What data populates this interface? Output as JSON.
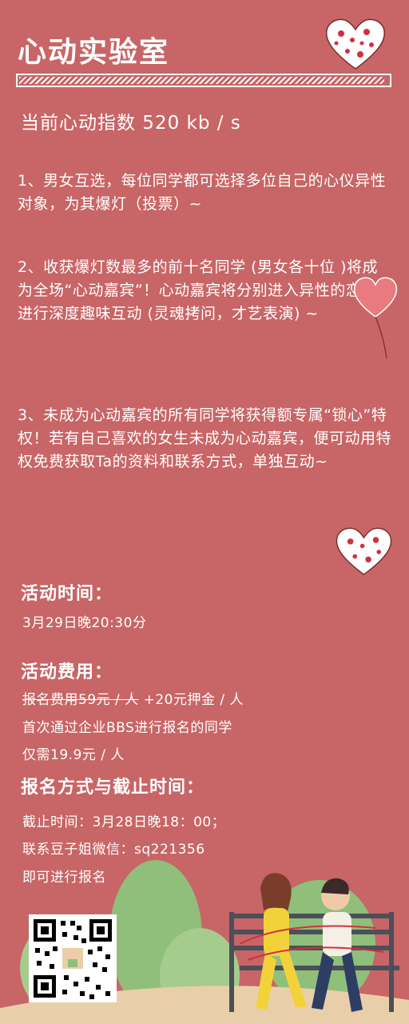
{
  "title": "心动实验室",
  "progress": 0.99,
  "index_text": "当前心动指数 520 kb / s",
  "rules": [
    "1、男女互选，每位同学都可选择多位自己的心仪异性对象，为其爆灯（投票）~",
    "2、收获爆灯数最多的前十名同学 (男女各十位 )将成为全场“心动嘉宾”！心动嘉宾将分别进入异性的恋爱群进行深度趣味互动 (灵魂拷问，才艺表演) ~",
    "3、未成为心动嘉宾的所有同学将获得额专属“锁心”特权！若有自己喜欢的女生未成为心动嘉宾，便可动用特权免费获取Ta的资料和联系方式，单独互动~"
  ],
  "time": {
    "heading": "活动时间：",
    "value": "3月29日晚20:30分"
  },
  "fee": {
    "heading": "活动费用：",
    "original": "报名费用59元 / 人",
    "deposit": " +20元押金 / 人",
    "note_line1": "首次通过企业BBS进行报名的同学",
    "note_line2": "仅需19.9元 / 人"
  },
  "signup": {
    "heading": "报名方式与截止时间：",
    "deadline": "截止时间：3月28日晚18：00；",
    "contact": "联系豆子姐微信：sq221356",
    "action": "即可进行报名"
  },
  "colors": {
    "background": "#c86566",
    "text": "#ffffff",
    "heart": "#e87a80",
    "bush": "#8fbf7a"
  }
}
